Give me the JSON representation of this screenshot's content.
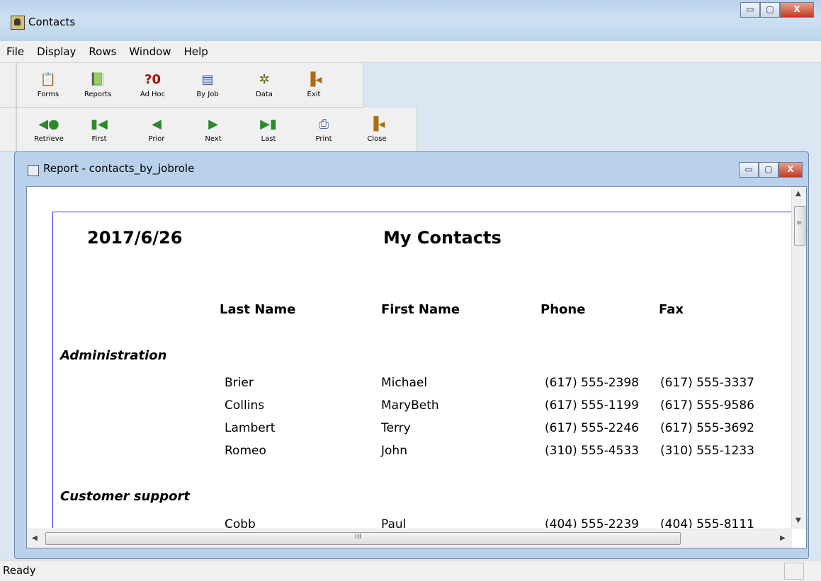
{
  "window": {
    "title": "Contacts",
    "minimize": "▭",
    "maximize": "▢",
    "close": "X"
  },
  "menu": [
    "File",
    "Display",
    "Rows",
    "Window",
    "Help"
  ],
  "toolbar1": [
    {
      "label": "Forms",
      "icon": "📋"
    },
    {
      "label": "Reports",
      "icon": "📗"
    },
    {
      "label": "Ad Hoc",
      "icon": "?0"
    },
    {
      "label": "By Job",
      "icon": "▤"
    },
    {
      "label": "Data",
      "icon": "✲"
    },
    {
      "label": "Exit",
      "icon": "▐◂"
    }
  ],
  "toolbar2": [
    {
      "label": "Retrieve",
      "icon": "◀●"
    },
    {
      "label": "First",
      "icon": "▮◀"
    },
    {
      "label": "Prior",
      "icon": "◀"
    },
    {
      "label": "Next",
      "icon": "▶"
    },
    {
      "label": "Last",
      "icon": "▶▮"
    },
    {
      "label": "Print",
      "icon": "⎙"
    },
    {
      "label": "Close",
      "icon": "▐◂"
    }
  ],
  "child": {
    "title": "Report - contacts_by_jobrole"
  },
  "report": {
    "date": "2017/6/26",
    "title": "My Contacts",
    "headers": {
      "last": "Last Name",
      "first": "First Name",
      "phone": "Phone",
      "fax": "Fax"
    },
    "groups": [
      {
        "name": "Administration",
        "rows": [
          {
            "last": "Brier",
            "first": "Michael",
            "phone": "(617) 555-2398",
            "fax": "(617) 555-3337"
          },
          {
            "last": "Collins",
            "first": "MaryBeth",
            "phone": "(617) 555-1199",
            "fax": "(617) 555-9586"
          },
          {
            "last": "Lambert",
            "first": "Terry",
            "phone": "(617) 555-2246",
            "fax": "(617) 555-3692"
          },
          {
            "last": "Romeo",
            "first": "John",
            "phone": "(310) 555-4533",
            "fax": "(310) 555-1233"
          }
        ]
      },
      {
        "name": "Customer support",
        "rows": [
          {
            "last": "Cobb",
            "first": "Paul",
            "phone": "(404) 555-2239",
            "fax": "(404) 555-8111"
          }
        ]
      }
    ]
  },
  "scroll": {
    "h_grip": "III",
    "v_grip": "≡"
  },
  "status": {
    "text": "Ready"
  }
}
